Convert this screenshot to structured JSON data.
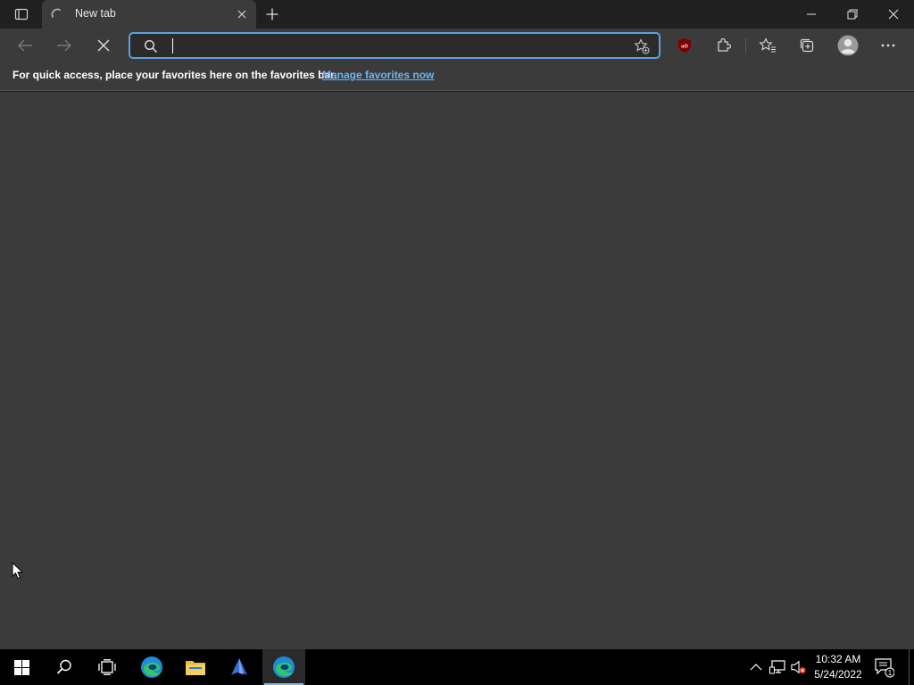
{
  "browser": {
    "tab": {
      "title": "New tab"
    },
    "favorites_bar": {
      "message": "For quick access, place your favorites here on the favorites bar.",
      "link": "Manage favorites now"
    },
    "address_bar": {
      "value": "",
      "placeholder": ""
    }
  },
  "taskbar": {
    "clock": {
      "time": "10:32 AM",
      "date": "5/24/2022"
    },
    "notification_count": "1"
  },
  "colors": {
    "accent": "#5aa0e6",
    "link": "#6cb4f5",
    "content_bg": "#3b3b3b",
    "titlebar_bg": "#202020",
    "taskbar_bg": "#000000"
  },
  "icons": {
    "toolbar": [
      "back-icon",
      "forward-icon",
      "stop-icon",
      "search-icon",
      "favorite-add-icon",
      "ublock-icon",
      "extensions-icon",
      "favorites-icon",
      "collections-icon",
      "profile-icon",
      "more-icon"
    ],
    "taskbar": [
      "windows-start-icon",
      "search-icon",
      "task-view-icon",
      "edge-icon",
      "file-explorer-icon",
      "app-icon",
      "edge-icon"
    ],
    "tray": [
      "chevron-up-icon",
      "network-icon",
      "volume-muted-icon",
      "notification-icon"
    ]
  }
}
